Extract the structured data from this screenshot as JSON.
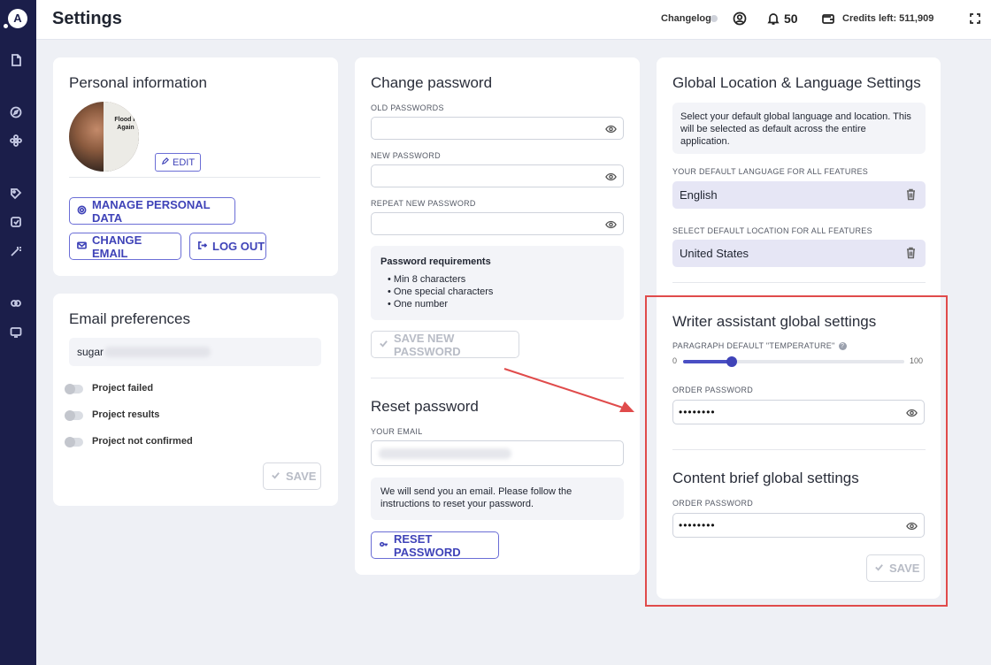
{
  "app": {
    "logo_letter": "A"
  },
  "sidebar": {
    "items": [
      {
        "icon": "document-icon"
      },
      {
        "icon": "compass-icon"
      },
      {
        "icon": "flower-icon"
      },
      {
        "icon": "tag-icon"
      },
      {
        "icon": "edit-check-icon"
      },
      {
        "icon": "magic-wand-icon"
      },
      {
        "icon": "link-icon"
      },
      {
        "icon": "monitor-icon"
      }
    ]
  },
  "header": {
    "title": "Settings",
    "changelog": "Changelog",
    "notifications": "50",
    "credits": "Credits left: 511,909"
  },
  "personal": {
    "title": "Personal information",
    "avatar_caption": "Flood It Again",
    "edit_label": "EDIT",
    "manage_label": "MANAGE PERSONAL DATA",
    "change_email_label": "CHANGE EMAIL",
    "logout_label": "LOG OUT"
  },
  "email_prefs": {
    "title": "Email preferences",
    "email_value": "sugar",
    "toggles": [
      {
        "label": "Project failed",
        "on": false
      },
      {
        "label": "Project results",
        "on": false
      },
      {
        "label": "Project not confirmed",
        "on": false
      }
    ],
    "save_label": "SAVE"
  },
  "change_password": {
    "title": "Change password",
    "old_label": "OLD PASSWORDS",
    "new_label": "NEW PASSWORD",
    "repeat_label": "REPEAT NEW PASSWORD",
    "req_title": "Password requirements",
    "requirements": [
      "Min 8 characters",
      "One special characters",
      "One number"
    ],
    "save_label": "SAVE NEW PASSWORD"
  },
  "reset_password": {
    "title": "Reset password",
    "email_label": "YOUR EMAIL",
    "info": "We will send you an email. Please follow the instructions to reset your password.",
    "button_label": "RESET PASSWORD"
  },
  "global_settings": {
    "title": "Global Location & Language Settings",
    "info": "Select your default global language and location. This will be selected as default across the entire application.",
    "language_label": "YOUR DEFAULT LANGUAGE FOR ALL FEATURES",
    "language_value": "English",
    "location_label": "SELECT DEFAULT LOCATION FOR ALL FEATURES",
    "location_value": "United States"
  },
  "writer": {
    "title": "Writer assistant global settings",
    "temp_label": "PARAGRAPH DEFAULT \"TEMPERATURE\"",
    "slider_min": "0",
    "slider_max": "100",
    "slider_value": 0.22,
    "order_label": "ORDER PASSWORD",
    "order_value": "••••••••"
  },
  "content_brief": {
    "title": "Content brief global settings",
    "order_label": "ORDER PASSWORD",
    "order_value": "••••••••",
    "save_label": "SAVE"
  },
  "colors": {
    "sidebar": "#1b1e4a",
    "accent": "#3f43b8",
    "highlight": "#e04b4b"
  }
}
